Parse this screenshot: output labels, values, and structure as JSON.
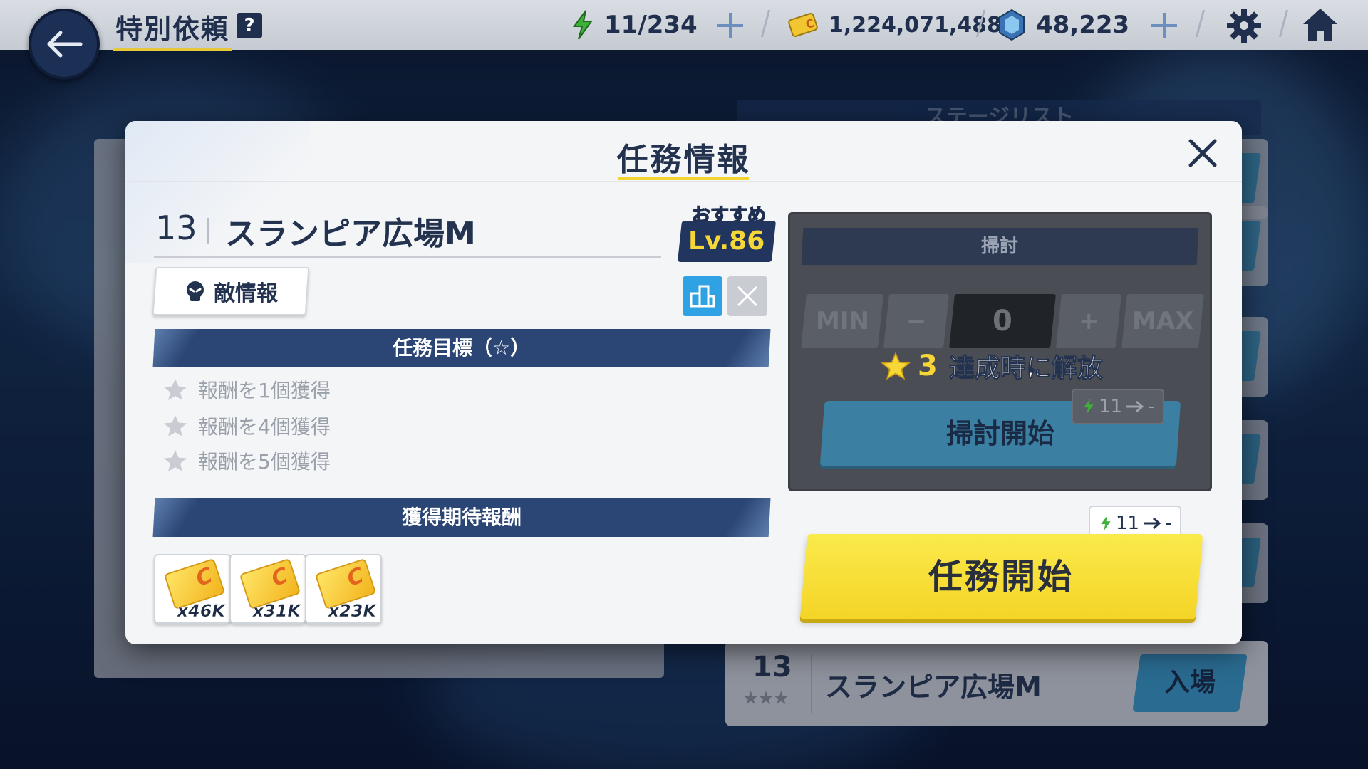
{
  "topbar": {
    "title": "特別依頼",
    "help_label": "?",
    "stamina": "11/234",
    "credits": "1,224,071,488",
    "gems": "48,223"
  },
  "background": {
    "stage_list_header": "ステージリスト",
    "bottom_card": {
      "number": "13",
      "name": "スランピア広場M",
      "enter_label": "入場"
    }
  },
  "modal": {
    "title": "任務情報",
    "stage_number": "13",
    "stage_name": "スランピア広場M",
    "recommend_label": "おすすめ",
    "recommend_level": "Lv.86",
    "enemy_info_label": "敵情報",
    "goals_header": "任務目標（☆）",
    "goals": [
      "報酬を1個獲得",
      "報酬を4個獲得",
      "報酬を5個獲得"
    ],
    "rewards_header": "獲得期待報酬",
    "rewards": [
      {
        "qty": "x46K",
        "icon": "credit-card-icon"
      },
      {
        "qty": "x31K",
        "icon": "credit-card-icon"
      },
      {
        "qty": "x23K",
        "icon": "credit-card-icon"
      }
    ],
    "sweep": {
      "header": "掃討",
      "min_label": "MIN",
      "minus_label": "−",
      "count": "0",
      "plus_label": "+",
      "max_label": "MAX",
      "unlock_stars": "3",
      "unlock_text": "達成時に解放",
      "cost": "11",
      "cost_after": "-",
      "button_label": "掃討開始"
    },
    "start": {
      "cost": "11",
      "cost_after": "-",
      "button_label": "任務開始"
    }
  },
  "colors": {
    "accent_yellow": "#f4d426",
    "navy": "#23324f",
    "section_blue": "#2b4574"
  }
}
